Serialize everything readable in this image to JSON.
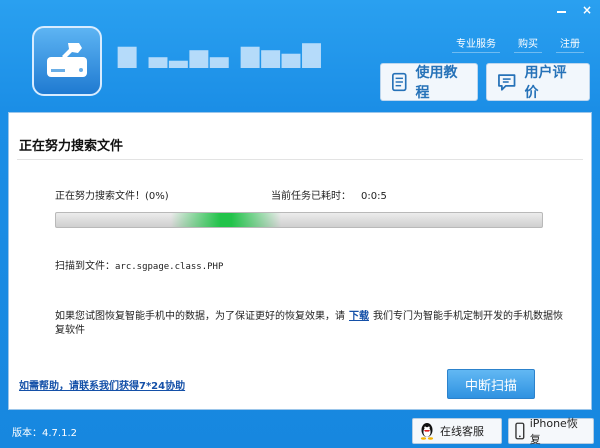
{
  "window": {
    "title": "",
    "controls": {
      "minimize": "",
      "close": "×"
    }
  },
  "header": {
    "links": [
      "专业服务",
      "购买",
      "注册"
    ],
    "buttons": [
      {
        "label": "使用教程",
        "icon": "document-icon"
      },
      {
        "label": "用户评价",
        "icon": "comment-icon"
      }
    ]
  },
  "scan": {
    "heading": "正在努力搜索文件",
    "status": "正在努力搜索文件！(0%)",
    "elapsed_label": "当前任务已耗时：",
    "elapsed_value": "0:0:5",
    "progress_percent": 0,
    "scanned_label": "扫描到文件：",
    "scanned_path": "arc.sgpage.class.PHP"
  },
  "notice": {
    "prefix": "如果您试图恢复智能手机中的数据，为了保证更好的恢复效果，请",
    "link": "下载",
    "suffix": "我们专门为智能手机定制开发的手机数据恢复软件"
  },
  "help_link": "如需帮助，请联系我们获得7*24协助",
  "stop_button": "中断扫描",
  "footer": {
    "version": "版本：4.7.1.2",
    "buttons": [
      {
        "label": "在线客服",
        "icon": "qq-penguin-icon"
      },
      {
        "label": "iPhone恢复",
        "icon": "phone-icon"
      }
    ]
  },
  "colors": {
    "header_blue": "#1b8ee6",
    "link_blue": "#1450a8",
    "progress_green": "#22c34a",
    "button_blue": "#2f92e1"
  }
}
